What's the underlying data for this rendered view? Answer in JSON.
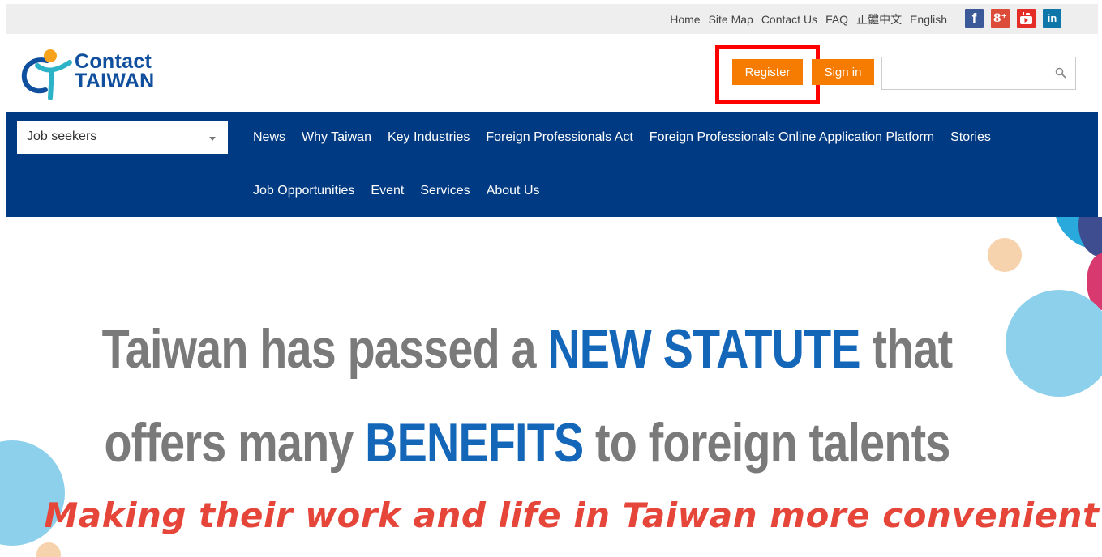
{
  "top_links": [
    "Home",
    "Site Map",
    "Contact Us",
    "FAQ",
    "正體中文",
    "English"
  ],
  "social": [
    {
      "name": "facebook-icon",
      "glyph": "f",
      "color": "#3b5998"
    },
    {
      "name": "google-plus-icon",
      "glyph": "8⁺",
      "color": "#dd4b39"
    },
    {
      "name": "youtube-icon",
      "glyph": "▶",
      "color": "#e52d27"
    },
    {
      "name": "linkedin-icon",
      "glyph": "in",
      "color": "#0e76a8"
    }
  ],
  "logo": {
    "line1": "Contact",
    "line2": "TAIWAN"
  },
  "header": {
    "register_label": "Register",
    "signin_label": "Sign in",
    "search_placeholder": ""
  },
  "nav": {
    "select_value": "Job seekers",
    "row1": [
      "News",
      "Why Taiwan",
      "Key Industries",
      "Foreign Professionals Act",
      "Foreign Professionals Online Application Platform",
      "Stories"
    ],
    "row2": [
      "Job Opportunities",
      "Event",
      "Services",
      "About Us"
    ]
  },
  "hero": {
    "line1_a": "Taiwan has passed a ",
    "line1_b": "NEW STATUTE",
    "line1_c": " that",
    "line2_a": "offers many ",
    "line2_b": "BENEFITS",
    "line2_c": " to foreign talents",
    "tagline": "Making their work and life in Taiwan more convenient"
  },
  "colors": {
    "accent_orange": "#f57c00",
    "nav_blue": "#003a82",
    "headline_grey": "#7a7a7a",
    "headline_blue": "#1467b8",
    "tagline_red": "#e6453a",
    "highlight_red": "#ff0000"
  }
}
